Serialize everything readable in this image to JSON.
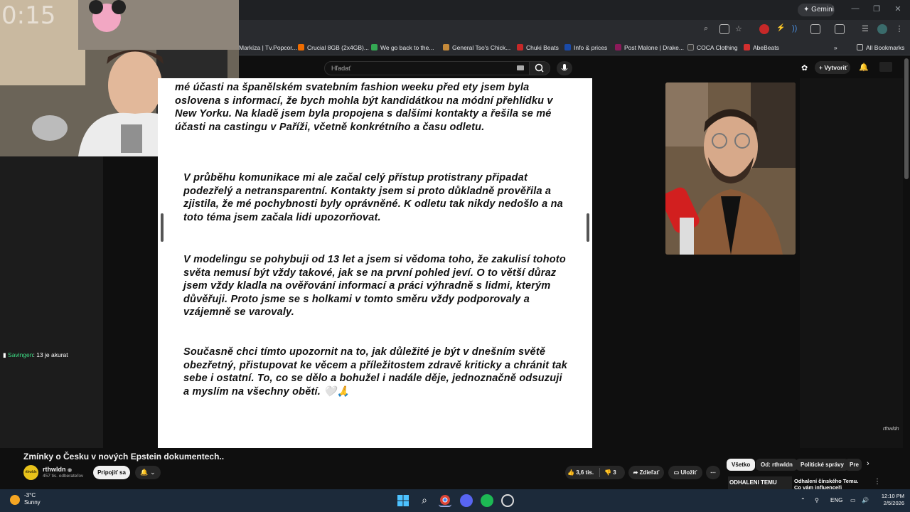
{
  "browser": {
    "gemini_label": "Gemini",
    "bookmarks": [
      {
        "label": "Markíza | Tv.Popcor...",
        "color": "#d93025"
      },
      {
        "label": "Crucial 8GB (2x4GB)...",
        "color": "#ef6c00"
      },
      {
        "label": "We go back to the...",
        "color": "#34a853"
      },
      {
        "label": "General Tso's Chick...",
        "color": "#c58a3a"
      },
      {
        "label": "Chuki Beats",
        "color": "#c62828"
      },
      {
        "label": "Info & prices",
        "color": "#1a4aa8"
      },
      {
        "label": "Post Malone | Drake...",
        "color": "#8b1a5a"
      },
      {
        "label": "COCA Clothing",
        "color": "#333333"
      },
      {
        "label": "AbeBeats",
        "color": "#d32f2f"
      }
    ],
    "all_bookmarks": "All Bookmarks"
  },
  "youtube": {
    "search_placeholder": "Hľadať",
    "create_label": "Vytvoriť"
  },
  "stream_overlay": {
    "timer": "0:15",
    "chat_user": "Savingen",
    "chat_message": ": 13 je akurat"
  },
  "document": {
    "paragraphs": [
      "mé účasti na španělském svatebním fashion weeku před ety jsem byla oslovena s informací, že bych mohla být kandidátkou na módní přehlídku v New Yorku. Na kladě jsem byla propojena s dalšími kontakty a řešila se mé účasti na castingu v Paříži, včetně konkrétního a času odletu.",
      "V průběhu komunikace mi ale začal celý přístup protistrany připadat podezřelý a netransparentní. Kontakty jsem si proto důkladně prověřila a zjistila, že mé pochybnosti byly oprávněné. K odletu tak nikdy nedošlo a na toto téma jsem začala lidi upozorňovat.",
      "V modelingu se pohybuji od 13 let a jsem si vědoma toho, že zakulisí tohoto světa nemusí být vždy takové, jak se na první pohled jeví. O to větší důraz jsem vždy kladla na ověřování informací a práci výhradně s lidmi, kterým důvěřuji. Proto jsme se s holkami v tomto směru vždy podporovaly a vzájemně se varovaly.",
      "Současně chci tímto upozornit na to, jak důležité je být v dnešním světě obezřetný, přistupovat ke věcem a příležitostem zdravě kriticky a chránit tak sebe i ostatní. To, co se dělo a bohužel i nadále děje, jednoznačně odsuzuji a myslím na všechny obětí. 🤍🙏"
    ]
  },
  "video": {
    "title": "Zmínky o Česku v nových Epstein dokumentech..",
    "channel_name": "rthwldn",
    "channel_avatar_text": "rthwldn",
    "subscribers": "457 tis. odberateľov",
    "subscribe_label": "Pripojiť sa",
    "likes": "3,6 tis.",
    "dislikes": "3",
    "share_label": "Zdieľať",
    "save_label": "Uložiť",
    "watermark": "rthwldn"
  },
  "recommendations": {
    "chips": [
      "Všetko",
      "Od: rthwldn",
      "Politické správy",
      "Pre"
    ],
    "first_thumb_text": "ODHALENI TEMU",
    "first_title": "Odhalení čínského Temu. Co vám influenceři neřeknou?"
  },
  "taskbar": {
    "temperature": "-3°C",
    "weather": "Sunny",
    "language": "ENG",
    "time": "12:10 PM",
    "date": "2/5/2026"
  }
}
